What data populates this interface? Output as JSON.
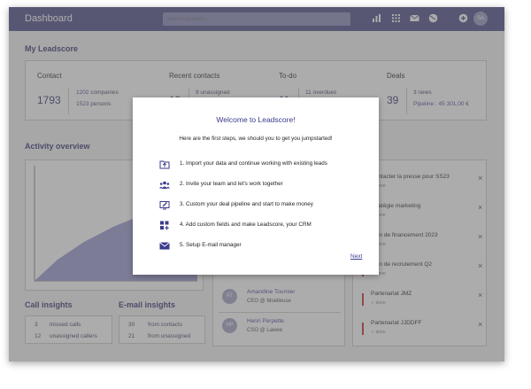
{
  "topbar": {
    "title": "Dashboard",
    "search_placeholder": "search contacts...",
    "icons": [
      "bar-chart-icon",
      "apps-grid-icon",
      "mail-icon",
      "globe-icon",
      "add-icon"
    ],
    "avatar": "SA"
  },
  "leadscore": {
    "title": "My Leadscore",
    "contact": {
      "label": "Contact",
      "count": "1793",
      "companies_count": "1202",
      "companies_label": "companies",
      "persons_count": "1523",
      "persons_label": "persons"
    },
    "recent": {
      "label": "Recent contacts",
      "count": "19",
      "unassigned": "9 unassigned"
    },
    "todo": {
      "label": "To-do",
      "count": "11",
      "overdues": "11 overdues"
    },
    "deals": {
      "label": "Deals",
      "count": "39",
      "news": "3 news",
      "pipeline": "Pipeline : 45 301,00 €"
    }
  },
  "activity": {
    "title": "Activity overview"
  },
  "contacts": [
    {
      "initials": "AT",
      "name": "Amandine Tournier",
      "role": "CEO @ Moelleuse"
    },
    {
      "initials": "HP",
      "name": "Henri Perpette",
      "role": "CSO @ Lawee"
    }
  ],
  "todos": [
    {
      "title": "Contacter la presse pour SS23",
      "status": "done"
    },
    {
      "title": "Stratégie marketing",
      "status": "done"
    },
    {
      "title": "Plan de financement 2023",
      "status": "done"
    },
    {
      "title": "Plan de recrutement Q2",
      "status": "done"
    },
    {
      "title": "Partenariat JMZ",
      "status": "done"
    },
    {
      "title": "Partenariat JJDDFF",
      "status": "done"
    }
  ],
  "call_insights": {
    "title": "Call insights",
    "rows": [
      {
        "value": "3",
        "label": "missed calls"
      },
      {
        "value": "12",
        "label": "unassigned callers"
      }
    ]
  },
  "email_insights": {
    "title": "E-mail insights",
    "rows": [
      {
        "value": "30",
        "label": "from contacts"
      },
      {
        "value": "21",
        "label": "from unassigned"
      }
    ]
  },
  "modal": {
    "title": "Welcome to Leadscore!",
    "subtitle": "Here are the first steps, we should you to get you jumpstarted!",
    "steps": [
      {
        "icon": "upload-folder-icon",
        "text": "1.  Import your data and continue working with existing leads"
      },
      {
        "icon": "team-icon",
        "text": "2.  Invite your team and let's work together"
      },
      {
        "icon": "pipeline-edit-icon",
        "text": "3.  Custom your deal pipeline and start to make money"
      },
      {
        "icon": "add-widget-icon",
        "text": "4.  Add custom fields and make Leadscore, your CRM"
      },
      {
        "icon": "mail-icon",
        "text": "5.  Setup E-mail manager"
      }
    ],
    "next_label": "Next"
  },
  "colors": {
    "brand": "#54548e",
    "accent": "#3a3a8c",
    "overdue": "#c23a3a"
  }
}
